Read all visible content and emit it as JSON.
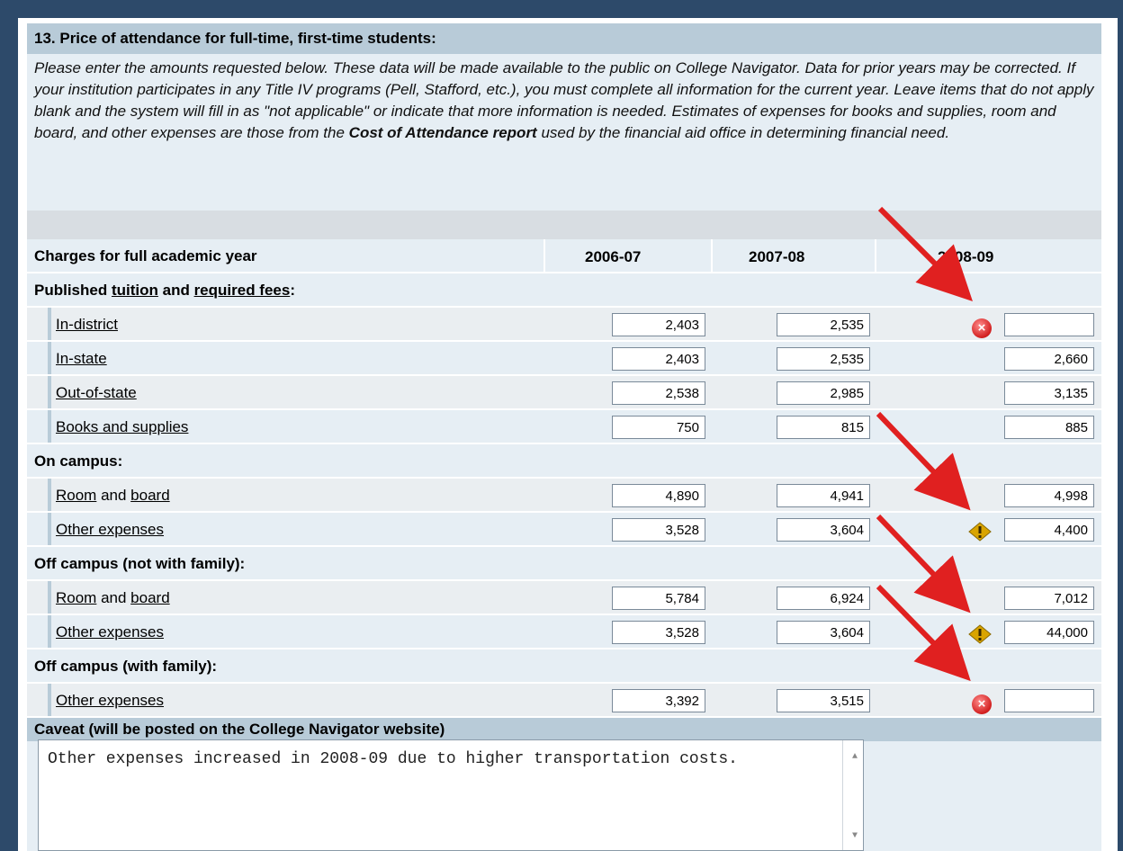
{
  "section": {
    "title": "13. Price of attendance for full-time, first-time students:",
    "intro_parts": [
      "Please enter the amounts requested below. These data will be made available to the public on College Navigator. Data for prior years may be corrected. If your institution participates in any Title IV programs (Pell, Stafford, etc.), you must complete all information for the current year. Leave items that do not apply blank and the system will fill in as \"not applicable\" or indicate that more information is needed. Estimates of expenses for books and supplies, room and board, and other expenses are those from the ",
      "Cost of Attendance report",
      " used by the financial aid office in determining financial need."
    ]
  },
  "table": {
    "header_label": "Charges for full academic year",
    "years": [
      "2006-07",
      "2007-08",
      "2008-09"
    ],
    "groups": {
      "published": {
        "prefix": "Published ",
        "link1": "tuition",
        "mid": " and ",
        "link2": "required fees",
        "suffix": ":"
      },
      "on_campus": "On campus:",
      "off_campus_not_family": "Off campus (not with family):",
      "off_campus_family": "Off campus (with family):"
    },
    "rows": {
      "in_district": {
        "label": "In-district",
        "v1": "2,403",
        "v2": "2,535",
        "v3": ""
      },
      "in_state": {
        "label": "In-state",
        "v1": "2,403",
        "v2": "2,535",
        "v3": "2,660"
      },
      "out_state": {
        "label": "Out-of-state",
        "v1": "2,538",
        "v2": "2,985",
        "v3": "3,135"
      },
      "books": {
        "label": "Books and supplies",
        "v1": "750",
        "v2": "815",
        "v3": "885"
      },
      "on_room": {
        "label_a": "Room",
        "label_mid": " and ",
        "label_b": "board",
        "v1": "4,890",
        "v2": "4,941",
        "v3": "4,998"
      },
      "on_other": {
        "label": "Other expenses",
        "v1": "3,528",
        "v2": "3,604",
        "v3": "4,400"
      },
      "off_room": {
        "label_a": "Room",
        "label_mid": " and ",
        "label_b": "board",
        "v1": "5,784",
        "v2": "6,924",
        "v3": "7,012"
      },
      "off_other": {
        "label": "Other expenses",
        "v1": "3,528",
        "v2": "3,604",
        "v3": "44,000"
      },
      "fam_other": {
        "label": "Other expenses",
        "v1": "3,392",
        "v2": "3,515",
        "v3": ""
      }
    }
  },
  "caveat": {
    "label": "Caveat (will be posted on the College Navigator website)",
    "text": "Other expenses increased in 2008-09 due to higher transportation costs."
  },
  "icons": {
    "error": "error-x-icon",
    "warning": "warning-diamond-icon",
    "error_color": "#d21f1f",
    "warning_color": "#d9a400",
    "arrow_color": "#e02020"
  }
}
